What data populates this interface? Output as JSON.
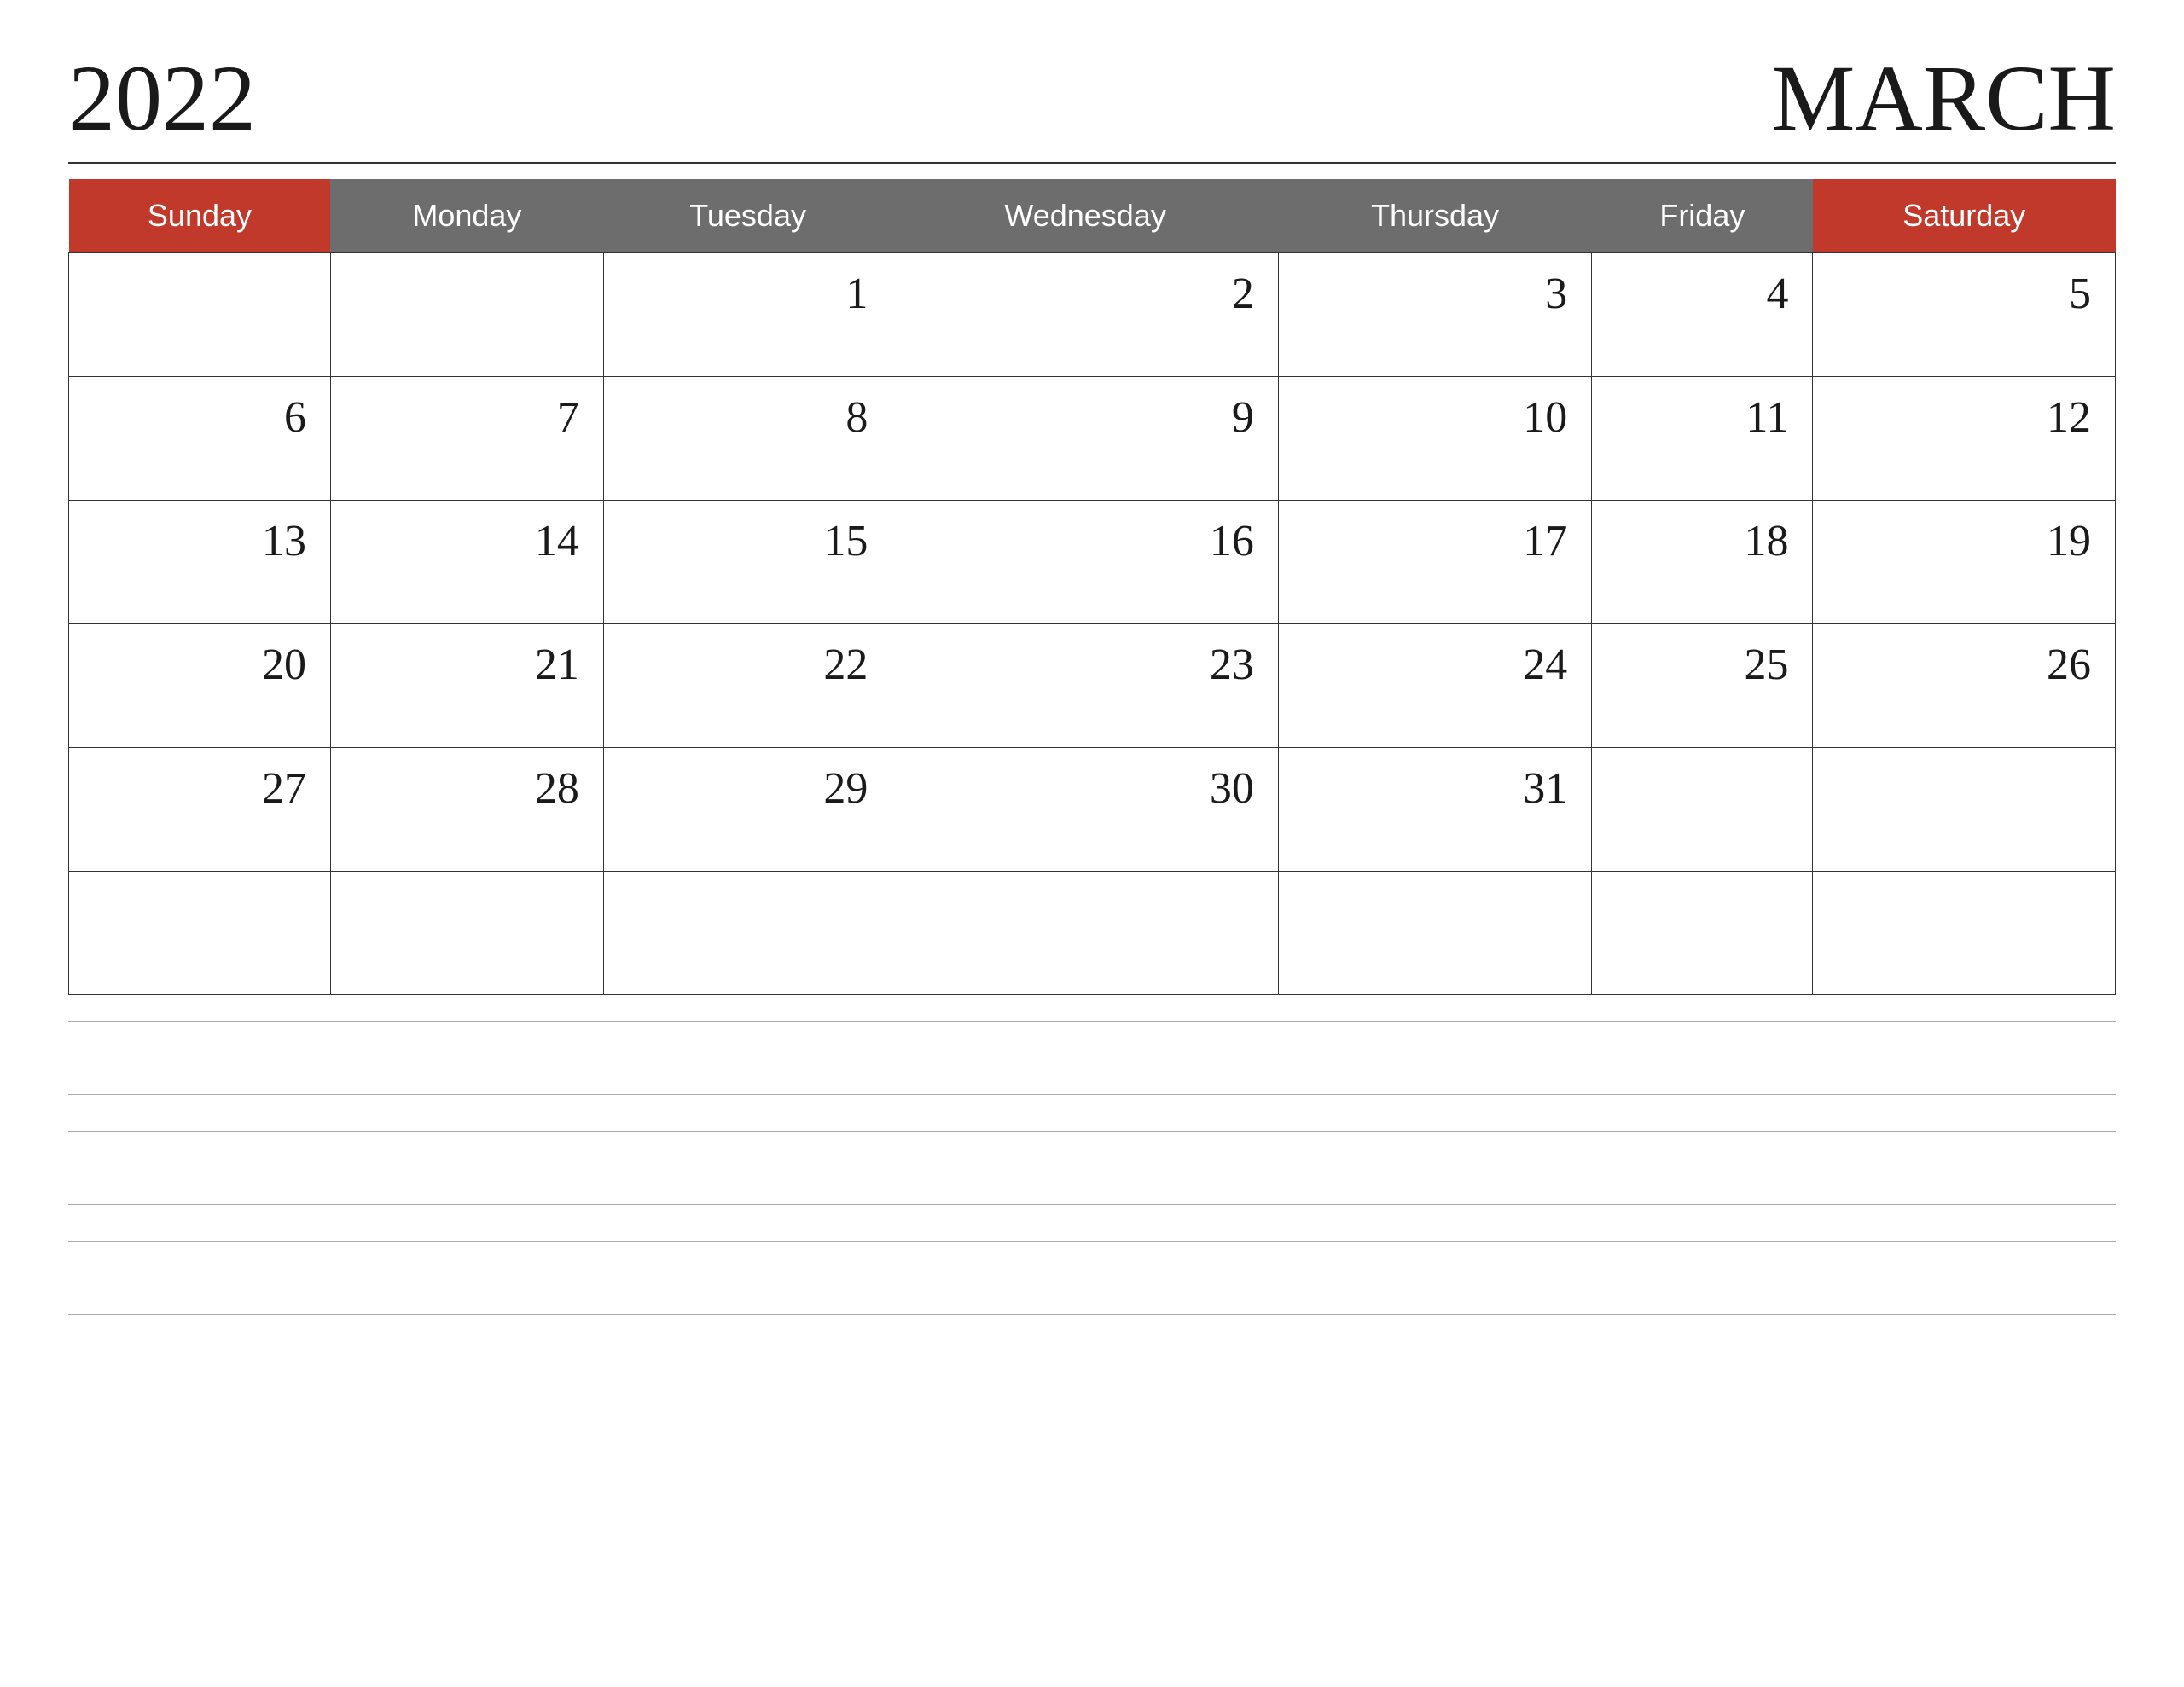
{
  "header": {
    "year": "2022",
    "month": "MARCH"
  },
  "days": {
    "sunday": "Sunday",
    "monday": "Monday",
    "tuesday": "Tuesday",
    "wednesday": "Wednesday",
    "thursday": "Thursday",
    "friday": "Friday",
    "saturday": "Saturday"
  },
  "weeks": [
    [
      "",
      "",
      "1",
      "2",
      "3",
      "4",
      "5"
    ],
    [
      "6",
      "7",
      "8",
      "9",
      "10",
      "11",
      "12"
    ],
    [
      "13",
      "14",
      "15",
      "16",
      "17",
      "18",
      "19"
    ],
    [
      "20",
      "21",
      "22",
      "23",
      "24",
      "25",
      "26"
    ],
    [
      "27",
      "28",
      "29",
      "30",
      "31",
      "",
      ""
    ],
    [
      "",
      "",
      "",
      "",
      "",
      "",
      ""
    ]
  ],
  "colors": {
    "red": "#c0392b",
    "gray": "#6d6d6d",
    "white": "#ffffff",
    "text": "#1a1a1a"
  }
}
